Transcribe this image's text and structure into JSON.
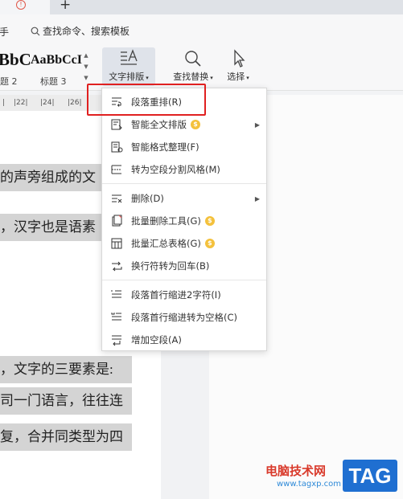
{
  "tabbar": {
    "add_label": "+"
  },
  "menubar": {
    "menu_fragment": "手",
    "search_label": "查找命令、搜索模板"
  },
  "ribbon": {
    "styles": [
      {
        "sample": "BbC",
        "label": "题 2"
      },
      {
        "sample": "AaBbCcI",
        "label": "标题 3"
      }
    ],
    "typeset_label": "文字排版",
    "find_label": "查找替换",
    "select_label": "选择"
  },
  "ruler": {
    "ticks": [
      "|22|",
      "|24|",
      "|26|"
    ]
  },
  "document": {
    "lines": [
      "的声旁组成的文",
      "，汉字也是语素",
      "，文字的三要素是:",
      "司一门语言，往往连",
      "复，合并同类型为四"
    ]
  },
  "dropdown": {
    "items": [
      {
        "label": "段落重排(R)",
        "icon": "paragraph-rearrange-icon"
      },
      {
        "label": "智能全文排版",
        "icon": "smart-layout-icon",
        "vip": true,
        "submenu": true
      },
      {
        "label": "智能格式整理(F)",
        "icon": "smart-format-icon"
      },
      {
        "label": "转为空段分割风格(M)",
        "icon": "empty-paragraph-style-icon"
      },
      {
        "label": "删除(D)",
        "icon": "delete-icon",
        "submenu": true
      },
      {
        "label": "批量删除工具(G)",
        "icon": "batch-delete-icon",
        "vip": true
      },
      {
        "label": "批量汇总表格(G)",
        "icon": "batch-summary-table-icon",
        "vip": true
      },
      {
        "label": "换行符转为回车(B)",
        "icon": "line-break-to-enter-icon"
      },
      {
        "label": "段落首行缩进2字符(I)",
        "icon": "first-line-indent-icon"
      },
      {
        "label": "段落首行缩进转为空格(C)",
        "icon": "indent-to-space-icon"
      },
      {
        "label": "增加空段(A)",
        "icon": "add-empty-paragraph-icon"
      }
    ],
    "vip_badge": "$"
  },
  "watermark": {
    "text": "电脑技术网",
    "url": "www.tagxp.com",
    "tag": "TAG"
  },
  "colors": {
    "highlight_border": "#e02020",
    "vip": "#f4c13c",
    "tag_bg": "#1f6fd1"
  }
}
